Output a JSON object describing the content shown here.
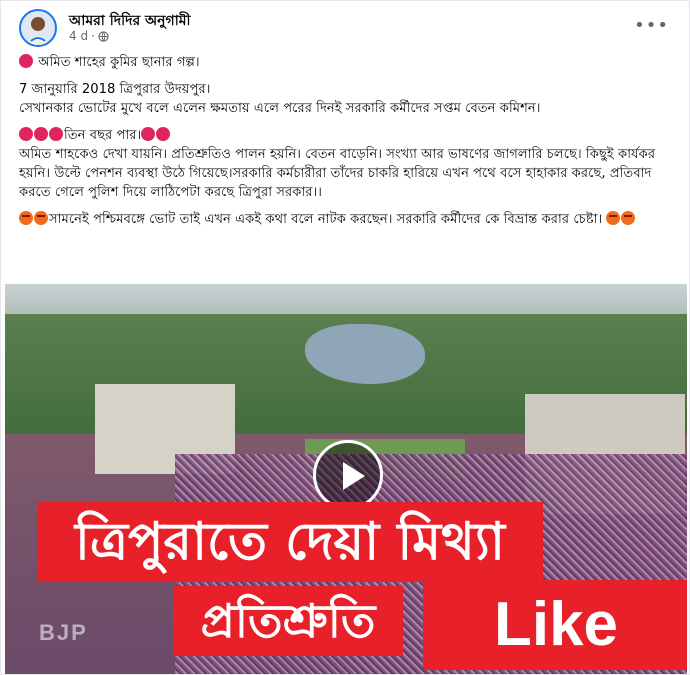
{
  "post": {
    "page_name": "আমরা দিদির অনুগামী",
    "time": "4 d",
    "privacy_icon": "globe-icon",
    "more_icon": "more-options-icon",
    "lines": [
      "অমিত শাহের কুমির ছানার গল্প।",
      "7 জানুয়ারি 2018 ত্রিপুরার উদয়পুর।",
      "সেখানকার ভোটের মুখে বলে এলেন ক্ষমতায় এলে পরের দিনই সরকারি কর্মীদের সপ্তম বেতন কমিশন।",
      "তিন বছর পার।",
      "অমিত শাহকেও দেখা যায়নি। প্রতিশ্রুতিও পালন হয়নি। বেতন বাড়েনি। সংখ্যা আর ভাষণের জাগলারি চলছে। কিছুই কার্যকর হয়নি। উল্টে পেনশন ব্যবস্থা উঠে গিয়েছে।সরকারি কর্মচারীরা তাঁদের চাকরি হারিয়ে এখন পথে বসে হাহাকার করছে, প্রতিবাদ করতে গেলে পুলিশ দিয়ে লাঠিপেটা করছে ত্রিপুরা সরকার।।",
      "সামনেই পশ্চিমবঙ্গে ভোট তাই এখন একই কথা বলে নাটক করছেন। সরকারি কর্মীদের কে বিভ্রান্ত করার চেষ্টা।"
    ]
  },
  "video": {
    "overlay_line1": "ত্রিপুরাতে দেয়া মিথ্যা",
    "overlay_line2": "প্রতিশ্রুতি",
    "like_text": "Like",
    "watermark": "BJP",
    "play_icon": "play-icon"
  },
  "colors": {
    "accent": "#1877f2",
    "banner_red": "#e8202a"
  }
}
